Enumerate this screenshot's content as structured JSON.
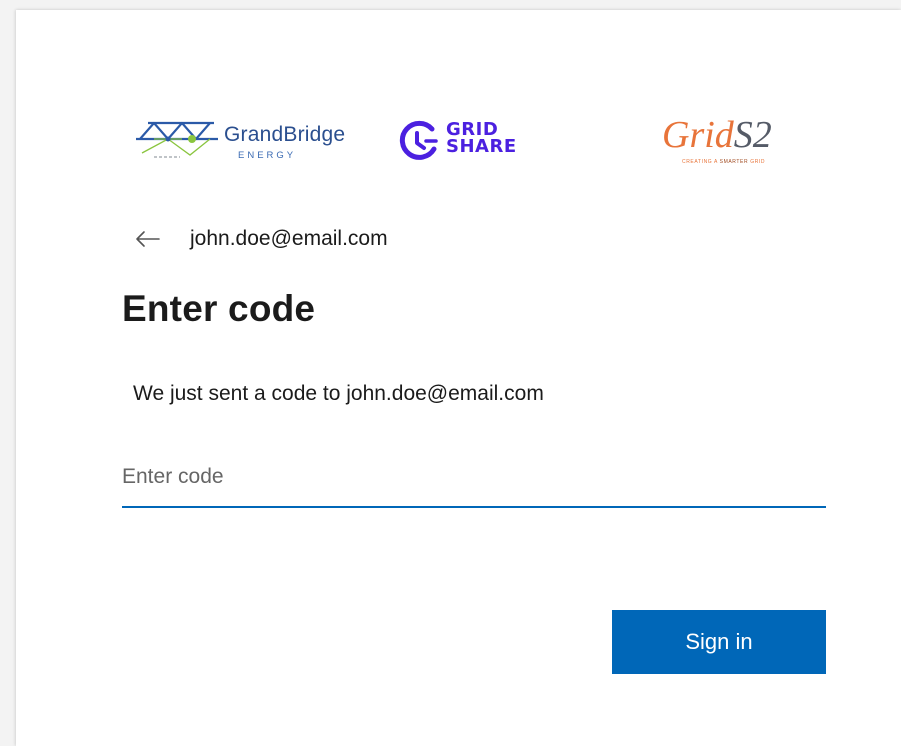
{
  "brand_logos": {
    "grandbridge": {
      "name": "GrandBridge",
      "sub": "ENERGY"
    },
    "gridshare": {
      "line1": "GRID",
      "line2": "SHARE"
    },
    "grids2": {
      "name_a": "Grid",
      "name_b": "S2",
      "tagline_a": "CREATING A",
      "tagline_b": "SMARTER",
      "tagline_c": "GRID"
    }
  },
  "identity": {
    "email": "john.doe@email.com",
    "back_icon": "arrow-left-icon"
  },
  "page": {
    "title": "Enter code",
    "description": "We just sent a code to john.doe@email.com"
  },
  "code_field": {
    "value": "",
    "placeholder": "Enter code"
  },
  "actions": {
    "signin_label": "Sign in"
  },
  "colors": {
    "accent": "#0067b8",
    "grandbridge_blue": "#2b4f8f",
    "gridshare_purple": "#4b20e0",
    "grids2_orange": "#e8743a"
  }
}
